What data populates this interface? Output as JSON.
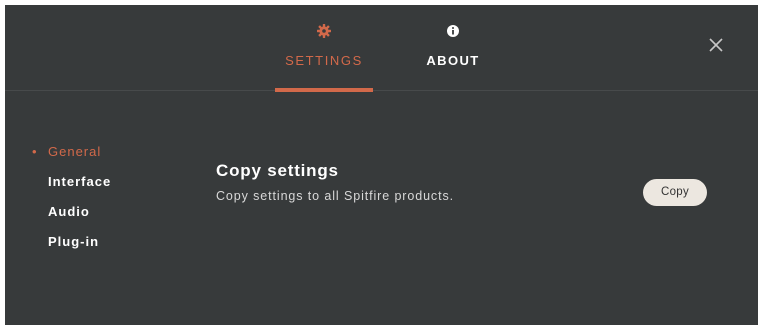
{
  "tabs": [
    {
      "label": "SETTINGS",
      "icon": "gear-icon",
      "active": true
    },
    {
      "label": "ABOUT",
      "icon": "info-icon",
      "active": false
    }
  ],
  "close_icon": "close-icon",
  "sidebar": {
    "items": [
      {
        "label": "General",
        "active": true
      },
      {
        "label": "Interface",
        "active": false
      },
      {
        "label": "Audio",
        "active": false
      },
      {
        "label": "Plug-in",
        "active": false
      }
    ]
  },
  "content": {
    "title": "Copy settings",
    "description": "Copy settings to all Spitfire products.",
    "button_label": "Copy"
  },
  "colors": {
    "background": "#373a3b",
    "accent": "#d2694a",
    "button_bg": "#ece7e0"
  }
}
